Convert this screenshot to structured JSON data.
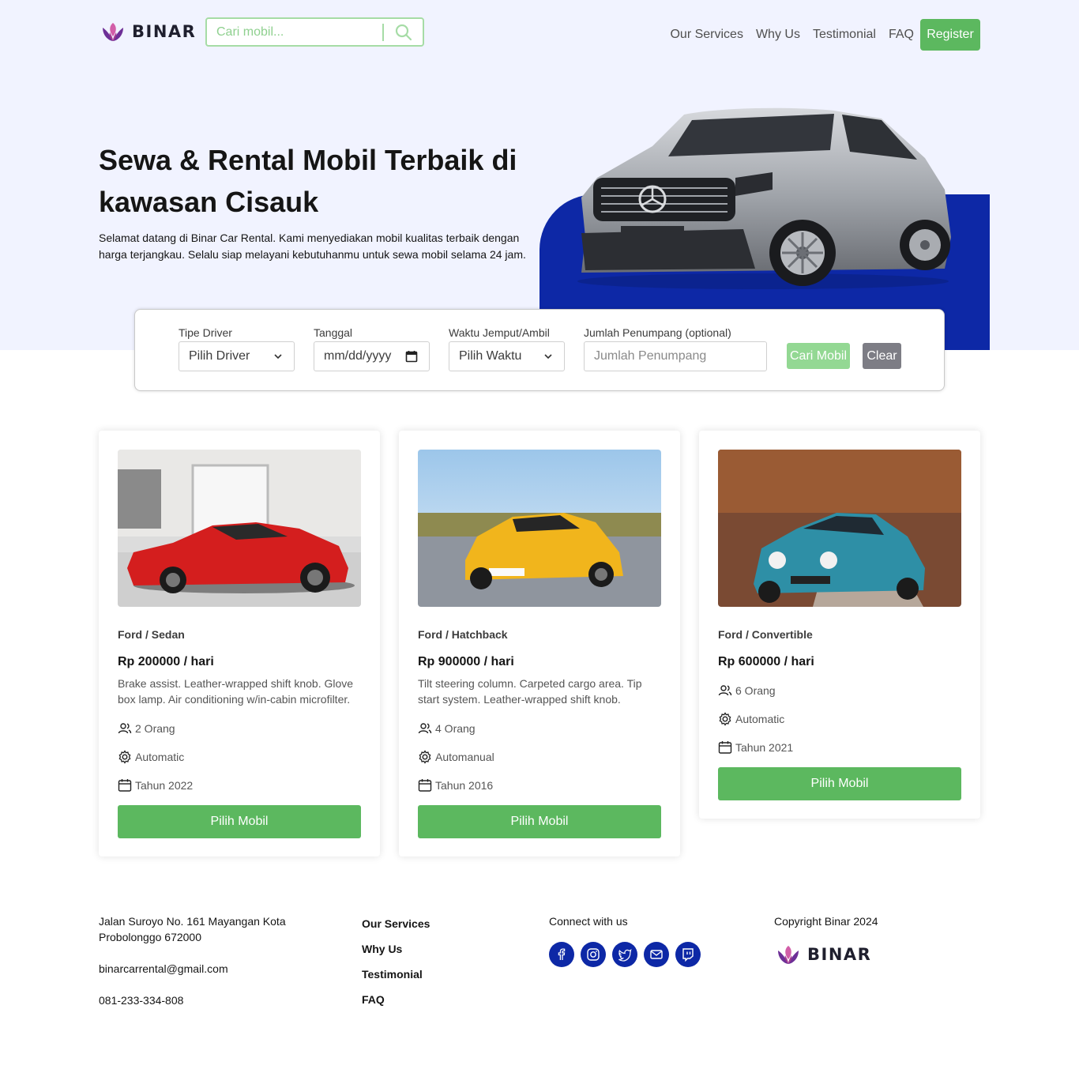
{
  "brand": {
    "name": "BINAR"
  },
  "search": {
    "placeholder": "Cari mobil..."
  },
  "nav": {
    "links": [
      "Our Services",
      "Why Us",
      "Testimonial",
      "FAQ"
    ],
    "register_label": "Register"
  },
  "hero": {
    "title": "Sewa & Rental Mobil Terbaik di kawasan Cisauk",
    "description": "Selamat datang di Binar Car Rental. Kami menyediakan mobil kualitas terbaik dengan harga terjangkau. Selalu siap melayani kebutuhanmu untuk sewa mobil selama 24 jam."
  },
  "filter": {
    "driver_label": "Tipe Driver",
    "driver_value": "Pilih Driver",
    "date_label": "Tanggal",
    "date_value": "mm/dd/yyyy",
    "time_label": "Waktu Jemput/Ambil",
    "time_value": "Pilih Waktu",
    "passenger_label": "Jumlah Penumpang (optional)",
    "passenger_placeholder": "Jumlah Penumpang",
    "search_label": "Cari Mobil",
    "clear_label": "Clear"
  },
  "cars": [
    {
      "name": "Ford / Sedan",
      "price": "Rp 200000 / hari",
      "description": "Brake assist. Leather-wrapped shift knob. Glove box lamp. Air conditioning w/in-cabin microfilter.",
      "capacity": "2 Orang",
      "transmission": "Automatic",
      "year": "Tahun 2022",
      "button": "Pilih Mobil"
    },
    {
      "name": "Ford / Hatchback",
      "price": "Rp 900000 / hari",
      "description": "Tilt steering column. Carpeted cargo area. Tip start system. Leather-wrapped shift knob.",
      "capacity": "4 Orang",
      "transmission": "Automanual",
      "year": "Tahun 2016",
      "button": "Pilih Mobil"
    },
    {
      "name": "Ford / Convertible",
      "price": "Rp 600000 / hari",
      "description": "",
      "capacity": "6 Orang",
      "transmission": "Automatic",
      "year": "Tahun 2021",
      "button": "Pilih Mobil"
    }
  ],
  "footer": {
    "address": "Jalan Suroyo No. 161 Mayangan Kota Probolonggo 672000",
    "email": "binarcarrental@gmail.com",
    "phone": "081-233-334-808",
    "links": [
      "Our Services",
      "Why Us",
      "Testimonial",
      "FAQ"
    ],
    "connect_label": "Connect with us",
    "social_icons": [
      "facebook-icon",
      "instagram-icon",
      "twitter-icon",
      "mail-icon",
      "twitch-icon"
    ],
    "copyright": "Copyright Binar 2024"
  },
  "colors": {
    "primary_green": "#5cb85f",
    "primary_blue": "#0d28a6",
    "hero_bg": "#f1f3ff",
    "brand_purple": "#7b3fa0"
  }
}
